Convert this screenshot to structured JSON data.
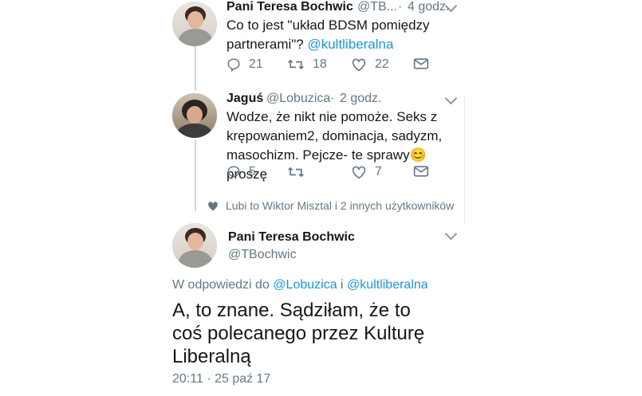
{
  "tweet1": {
    "name": "Pani Teresa Bochwic",
    "handle": "@TB...",
    "dot": "·",
    "time": "4 godz.",
    "text_main": "Co to jest \"układ BDSM pomiędzy partnerami\"? ",
    "mention": "@kultliberalna",
    "replies": "21",
    "retweets": "18",
    "likes": "22"
  },
  "tweet2": {
    "name": "Jaguś",
    "handle": "@Lobuzica",
    "dot": "·",
    "time": "2 godz.",
    "text_main": "Wodze, że nikt nie pomoże. Seks z krępowaniem2, dominacja, sadyzm, masochizm. Pejcze- te sprawy",
    "emoji": "😊",
    "text_end": " proszę",
    "replies": "5",
    "retweets": "",
    "likes": "7"
  },
  "liked_by": "Lubi to Wiktor Misztal i 2 innych użytkowników",
  "tweet3": {
    "name": "Pani Teresa Bochwic",
    "handle": "@TBochwic",
    "reply_prefix": "W odpowiedzi do ",
    "reply_mention1": "@Lobuzica",
    "reply_and": " i ",
    "reply_mention2": "@kultliberalna",
    "text": "A, to znane. Sądziłam, że to coś polecanego przez Kulturę Liberalną",
    "timestamp": "20:11 · 25 paź 17"
  },
  "colors": {
    "link": "#1b95e0",
    "meta": "#657786",
    "thread": "#ccd6dd"
  },
  "icons": [
    "reply-icon",
    "retweet-icon",
    "like-icon",
    "dm-icon",
    "chevron-down-icon",
    "heart-icon"
  ]
}
